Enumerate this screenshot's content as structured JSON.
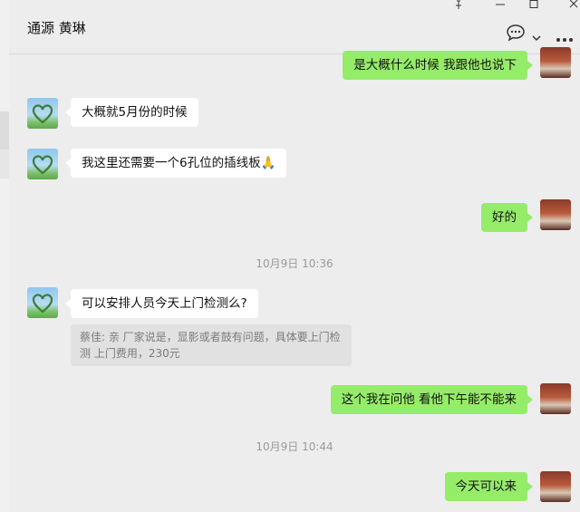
{
  "header": {
    "title": "通源 黄琳"
  },
  "window_controls": [
    "pin-icon",
    "minimize-icon",
    "maximize-icon",
    "close-icon"
  ],
  "colors": {
    "outgoing_bubble": "#95ec69",
    "incoming_bubble": "#ffffff",
    "background": "#ededed"
  },
  "messages": [
    {
      "from": "me",
      "text": "是大概什么时候 我跟他也说下"
    },
    {
      "from": "other",
      "text": "大概就5月份的时候"
    },
    {
      "from": "other",
      "text": "我这里还需要一个6孔位的插线板🙏"
    },
    {
      "from": "me",
      "text": "好的"
    },
    {
      "timestamp": "10月9日 10:36"
    },
    {
      "from": "other",
      "text": "可以安排人员今天上门检测么?",
      "quote": "蔡佳: 亲 厂家说是，显影或者鼓有问题，具体要上门检测  上门费用，230元"
    },
    {
      "from": "me",
      "text": "这个我在问他 看他下午能不能来"
    },
    {
      "timestamp": "10月9日 10:44"
    },
    {
      "from": "me",
      "text": "今天可以来"
    }
  ]
}
